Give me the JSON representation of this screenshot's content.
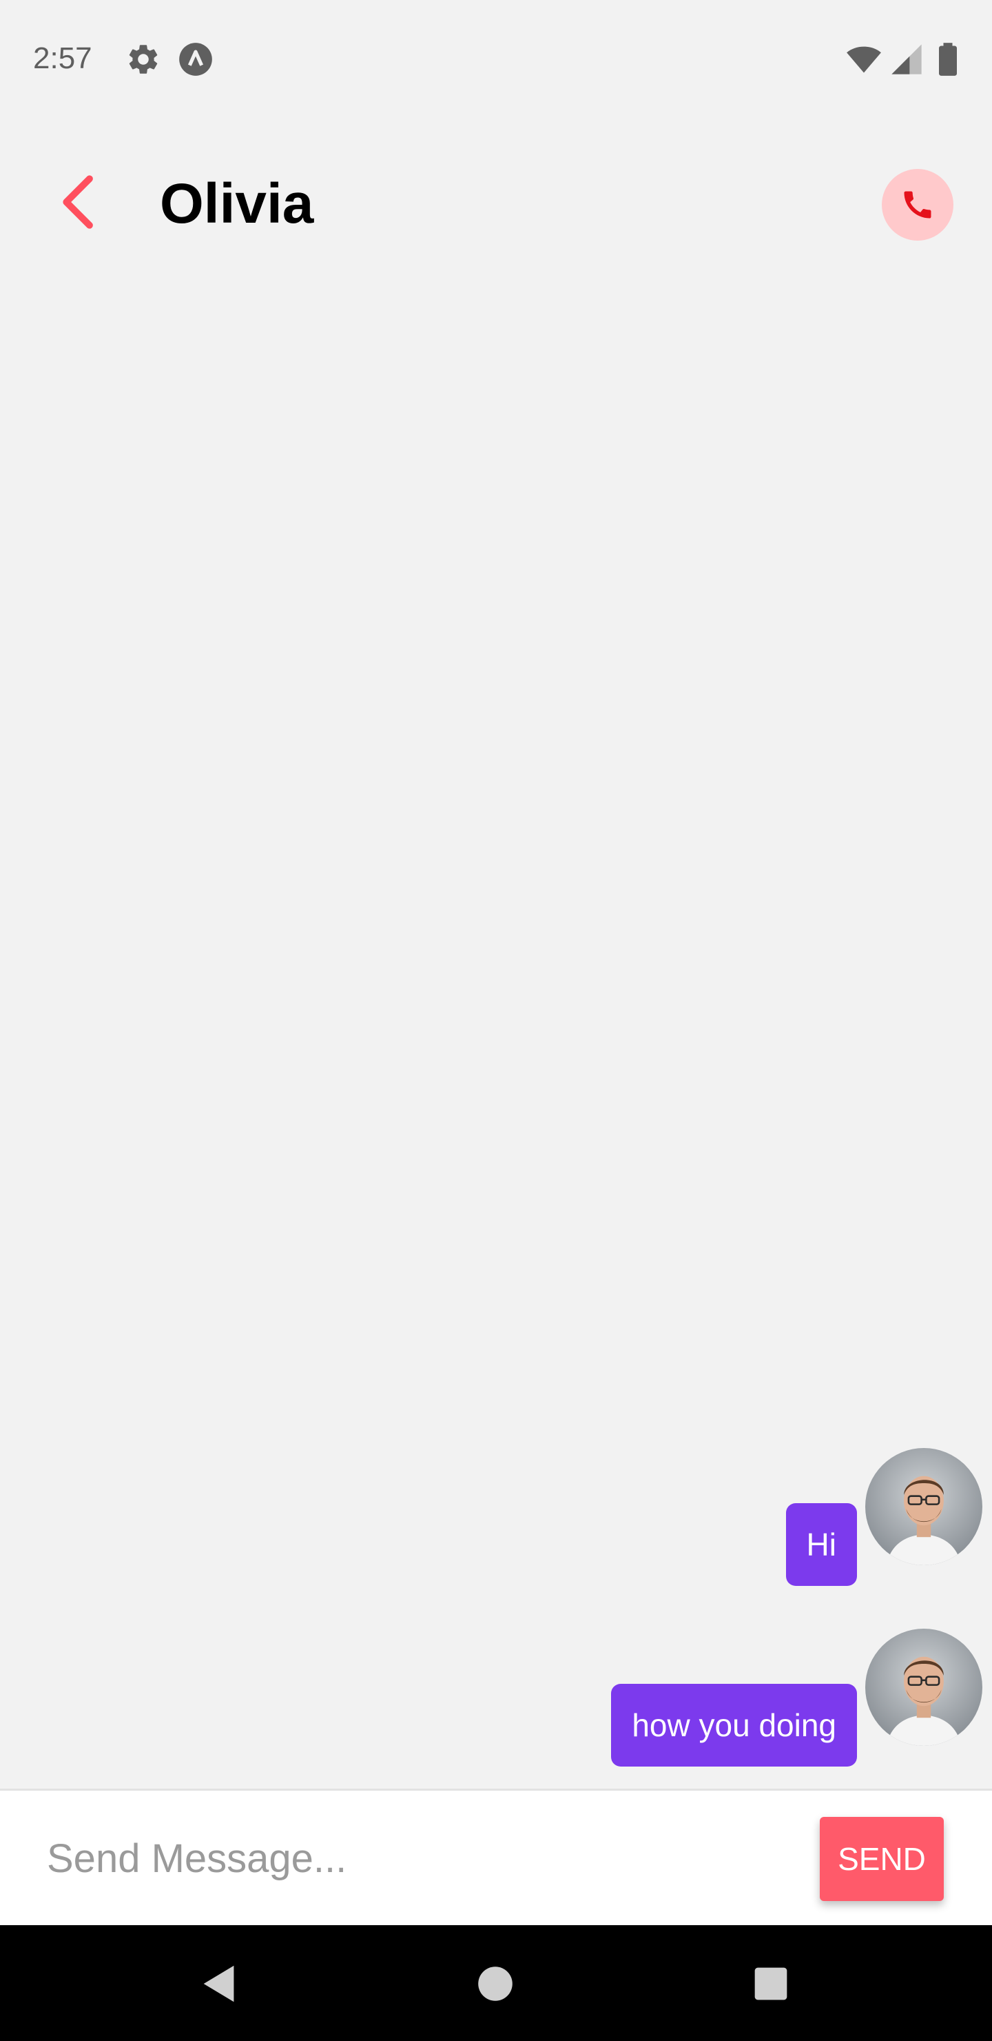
{
  "status_bar": {
    "time": "2:57",
    "icons": [
      "gear-icon",
      "app-launcher-icon",
      "wifi-icon",
      "signal-icon",
      "battery-icon"
    ]
  },
  "header": {
    "title": "Olivia",
    "back_icon": "chevron-left-icon",
    "call_icon": "phone-icon",
    "accent_color": "#ff4f5e"
  },
  "messages": [
    {
      "text": "Hi",
      "sender": "me"
    },
    {
      "text": "how you doing",
      "sender": "me"
    }
  ],
  "composer": {
    "placeholder": "Send Message...",
    "value": "",
    "send_label": "SEND",
    "send_color": "#ff5a6a"
  },
  "bubble_color": "#7c3aed",
  "nav_bar": {
    "buttons": [
      "back-triangle-icon",
      "home-circle-icon",
      "recents-square-icon"
    ]
  }
}
